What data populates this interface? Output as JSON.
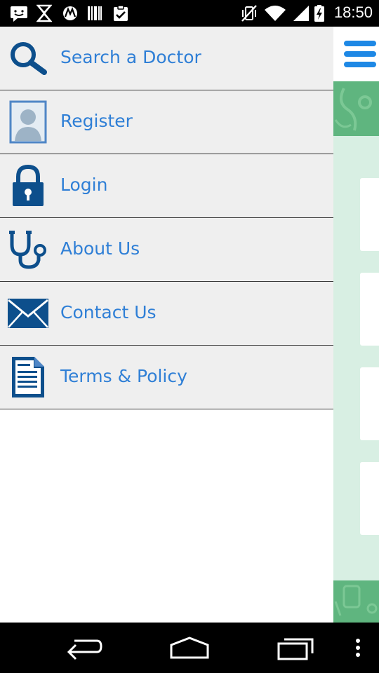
{
  "status_bar": {
    "time": "18:50",
    "icons": [
      "messenger-icon",
      "missed-call-icon",
      "motorola-icon",
      "barcode-icon",
      "clipboard-check-icon",
      "vibrate-off-icon",
      "wifi-icon",
      "signal-icon",
      "battery-charging-icon"
    ]
  },
  "drawer": {
    "items": [
      {
        "label": "Search a Doctor",
        "icon": "search-icon"
      },
      {
        "label": "Register",
        "icon": "user-profile-icon"
      },
      {
        "label": "Login",
        "icon": "lock-icon"
      },
      {
        "label": "About Us",
        "icon": "stethoscope-icon"
      },
      {
        "label": "Contact Us",
        "icon": "envelope-icon"
      },
      {
        "label": "Terms & Policy",
        "icon": "document-icon"
      }
    ]
  },
  "colors": {
    "accent": "#2f7fd6",
    "icon_blue": "#0d4f8c",
    "drawer_item_bg": "#efefef",
    "banner_green": "#5fb57f",
    "content_bg": "#d8efe3",
    "menu_button": "#1e88e5"
  },
  "nav_bar": {
    "buttons": [
      "back-icon",
      "home-icon",
      "recent-apps-icon",
      "overflow-menu-icon"
    ]
  }
}
